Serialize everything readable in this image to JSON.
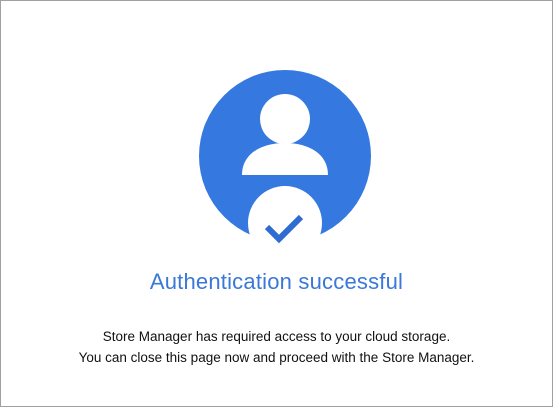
{
  "auth": {
    "title": "Authentication successful",
    "message_line1": "Store Manager has required access to your cloud storage.",
    "message_line2": "You can close this page now and proceed with the Store Manager."
  },
  "icons": {
    "avatar": "user-avatar-icon",
    "check": "checkmark-icon"
  },
  "colors": {
    "accent": "#3578e0",
    "title": "#3a78d8",
    "text": "#111111",
    "background": "#ffffff",
    "border": "#a0a0a0"
  }
}
